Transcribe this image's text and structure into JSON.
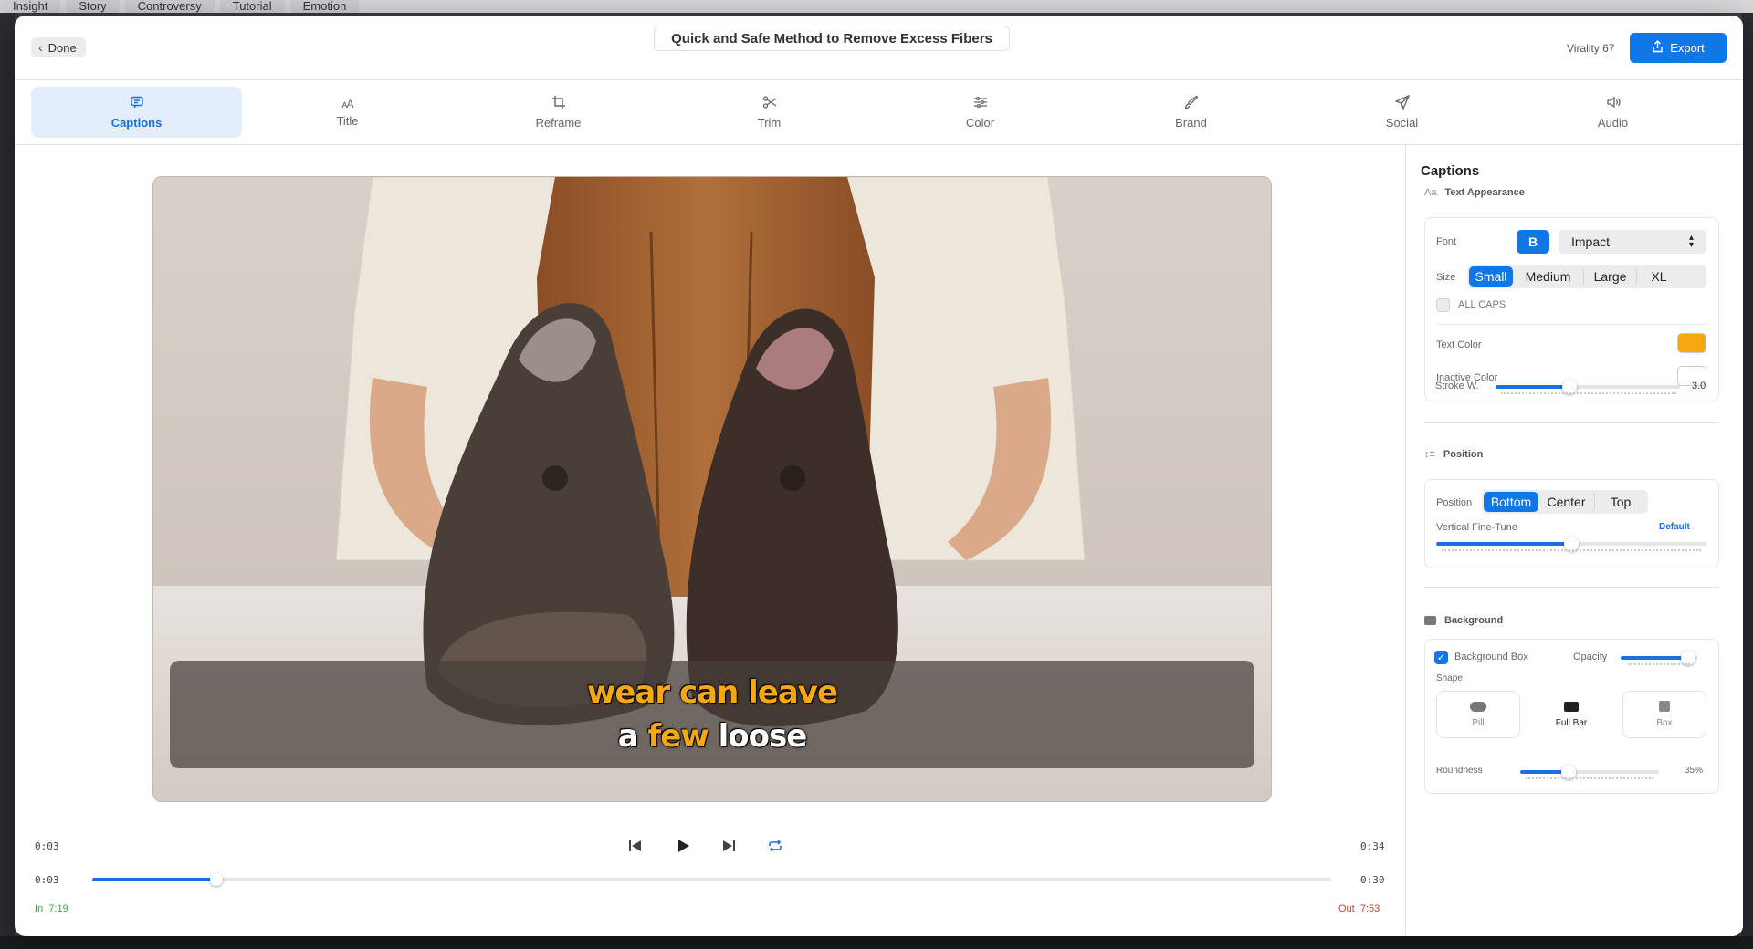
{
  "background_app": {
    "tabs": [
      "Insight",
      "Story",
      "Controversy",
      "Tutorial",
      "Emotion"
    ]
  },
  "header": {
    "done_label": "Done",
    "clip_title": "Quick and Safe Method to Remove Excess Fibers",
    "virality": "Virality 67",
    "export_label": "Export"
  },
  "toolbar": {
    "tabs": [
      {
        "label": "Captions",
        "icon": "caption-bubble-icon",
        "active": true
      },
      {
        "label": "Title",
        "icon": "text-size-icon",
        "active": false
      },
      {
        "label": "Reframe",
        "icon": "crop-icon",
        "active": false
      },
      {
        "label": "Trim",
        "icon": "scissors-icon",
        "active": false
      },
      {
        "label": "Color",
        "icon": "sliders-icon",
        "active": false
      },
      {
        "label": "Brand",
        "icon": "brush-icon",
        "active": false
      },
      {
        "label": "Social",
        "icon": "send-icon",
        "active": false
      },
      {
        "label": "Audio",
        "icon": "speaker-icon",
        "active": false
      }
    ]
  },
  "video": {
    "caption_line1": [
      "wear",
      "can",
      "leave"
    ],
    "caption_line2": [
      "a",
      "few",
      "loose"
    ],
    "line2_active": [
      false,
      true,
      false
    ]
  },
  "playback": {
    "current_time": "0:03",
    "total_time": "0:34",
    "scrub_start": "0:03",
    "scrub_end": "0:30",
    "scrub_progress": 0.1,
    "in_label": "In",
    "in_time": "7:19",
    "out_label": "Out",
    "out_time": "7:53"
  },
  "panel": {
    "title": "Captions",
    "text_appearance": {
      "heading": "Text Appearance",
      "icon_text": "Aa",
      "font_label": "Font",
      "bold_label": "B",
      "font_value": "Impact",
      "size_label": "Size",
      "sizes": [
        "Small",
        "Medium",
        "Large",
        "XL"
      ],
      "active_size": "Small",
      "all_caps_label": "ALL CAPS",
      "text_color_label": "Text Color",
      "text_color": "#f5a80f",
      "inactive_color_label": "Inactive Color",
      "inactive_color": "#ffffff",
      "stroke_label": "Stroke W.",
      "stroke_value": "3.0",
      "stroke_fraction": 0.4
    },
    "position": {
      "heading": "Position",
      "position_label": "Position",
      "options": [
        "Bottom",
        "Center",
        "Top"
      ],
      "active": "Bottom",
      "fine_tune_label": "Vertical Fine-Tune",
      "default_label": "Default",
      "fine_tune_fraction": 0.5
    },
    "background": {
      "heading": "Background",
      "box_label": "Background Box",
      "box_checked": true,
      "opacity_label": "Opacity",
      "opacity_fraction": 0.88,
      "shape_label": "Shape",
      "shapes": [
        "Pill",
        "Full Bar",
        "Box"
      ],
      "active_shape": "Full Bar",
      "roundness_label": "Roundness",
      "roundness_value": "35%",
      "roundness_fraction": 0.35
    }
  },
  "colors": {
    "accent": "#1277e6",
    "caption_active": "#f5a815",
    "in_green": "#2fa84f",
    "out_red": "#d93a2e"
  }
}
